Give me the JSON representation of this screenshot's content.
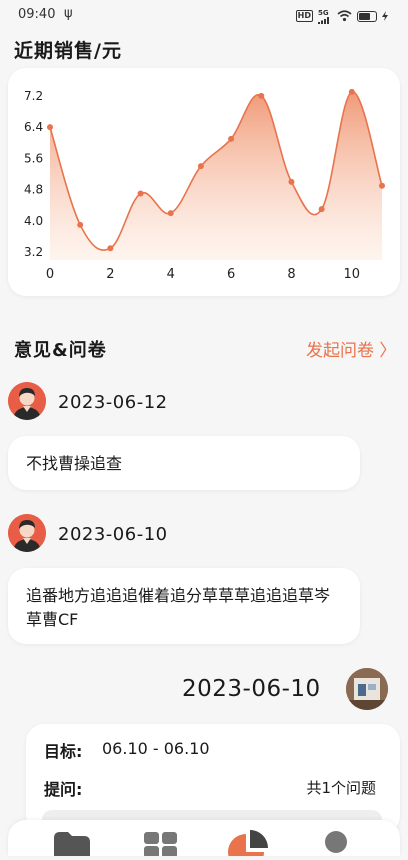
{
  "status_bar": {
    "time": "09:40",
    "usb_symbol": "ψ",
    "hd": "HD",
    "net": "5G"
  },
  "sales": {
    "title": "近期销售/元"
  },
  "chart_data": {
    "type": "line",
    "title": "",
    "x": [
      0,
      1,
      2,
      3,
      4,
      5,
      6,
      7,
      8,
      9,
      10,
      11
    ],
    "values": [
      6.4,
      3.9,
      3.3,
      4.7,
      4.2,
      5.4,
      6.1,
      7.2,
      5.0,
      4.3,
      7.3,
      4.9
    ],
    "xticks": [
      "0",
      "2",
      "4",
      "6",
      "8",
      "10"
    ],
    "yticks": [
      "3.2",
      "4.0",
      "4.8",
      "5.6",
      "6.4",
      "7.2"
    ],
    "ylim": [
      3.0,
      7.4
    ],
    "smooth": true,
    "area_fill": true,
    "colors": {
      "line": "#e8734c",
      "fill_top": "#f09a78",
      "fill_bottom": "#fde4d6"
    }
  },
  "feedback": {
    "title": "意见&问卷",
    "action": "发起问卷 〉"
  },
  "messages": [
    {
      "date": "2023-06-12",
      "text": "不找曹操追查"
    },
    {
      "date": "2023-06-10",
      "text": "追番地方追追追催着追分草草草追追追草岑草曹CF"
    }
  ],
  "survey": {
    "date": "2023-06-10",
    "target_label": "目标:",
    "target_value": "06.10 - 06.10",
    "question_label": "提问:",
    "question_count": "共1个问题"
  },
  "nav": {
    "items": [
      "folder-icon",
      "grid-icon",
      "pie-chart-icon",
      "profile-icon"
    ]
  }
}
